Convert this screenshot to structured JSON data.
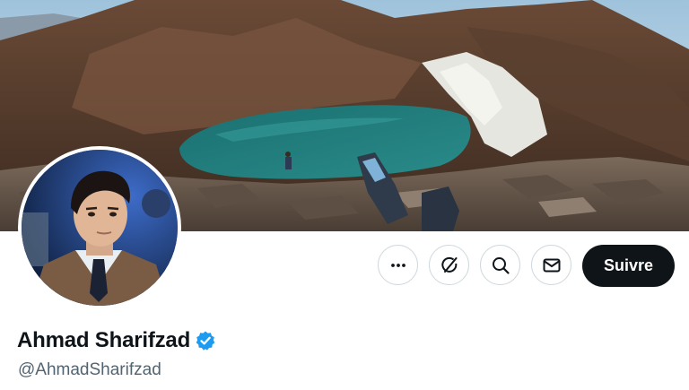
{
  "profile": {
    "display_name": "Ahmad Sharifzad",
    "handle": "@AhmadSharifzad",
    "verified": true
  },
  "actions": {
    "more_icon": "more-horizontal-icon",
    "grok_icon": "grok-icon",
    "search_icon": "search-icon",
    "message_icon": "mail-icon",
    "follow_label": "Suivre"
  },
  "colors": {
    "follow_bg": "#0f1419",
    "verified_blue": "#1d9bf0",
    "handle_gray": "#536471",
    "button_border": "#cfd9de"
  }
}
